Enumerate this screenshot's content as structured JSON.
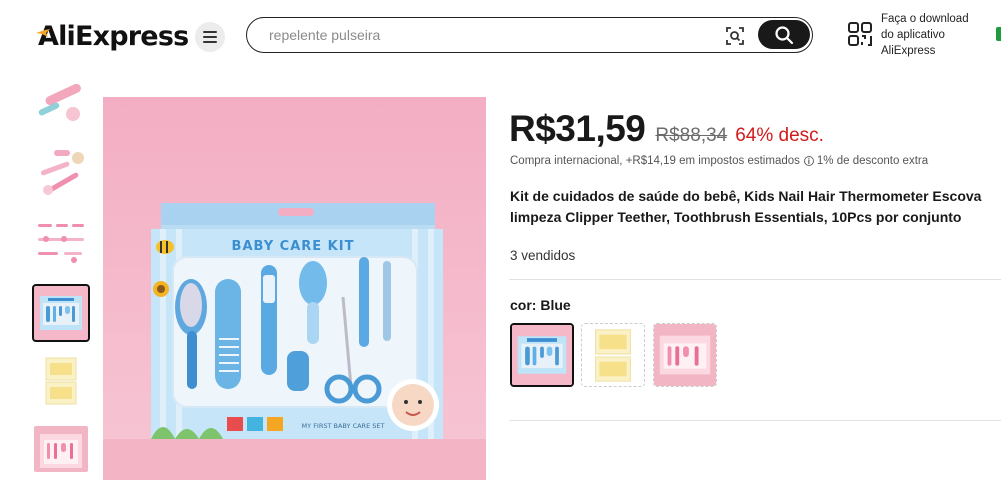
{
  "header": {
    "logo_text": "AliExpress",
    "search": {
      "placeholder": "repelente pulseira",
      "value": ""
    },
    "download_lines": [
      "Faça o download",
      "do aplicativo",
      "AliExpress"
    ]
  },
  "gallery": {
    "thumbnails": [
      {
        "name": "thumb-1",
        "selected": false
      },
      {
        "name": "thumb-2",
        "selected": false
      },
      {
        "name": "thumb-3",
        "selected": false
      },
      {
        "name": "thumb-4",
        "selected": true
      },
      {
        "name": "thumb-5",
        "selected": false
      },
      {
        "name": "thumb-6",
        "selected": false
      }
    ],
    "main_image": {
      "box_title": "BABY CARE KIT",
      "box_footer": "MY FIRST BABY CARE SET"
    }
  },
  "product": {
    "price": "R$31,59",
    "old_price": "R$88,34",
    "discount": "64% desc.",
    "tax_text": "Compra internacional, +R$14,19 em impostos estimados",
    "info_icon": "i",
    "extra_discount": "1% de desconto extra",
    "title_line1": "Kit de cuidados de saúde do bebê, Kids Nail Hair Thermometer Escova",
    "title_line2": "limpeza Clipper Teether, Toothbrush Essentials, 10Pcs por conjunto",
    "sold": "3 vendidos",
    "color_label": "cor: Blue",
    "variants": [
      {
        "name": "Blue",
        "selected": true
      },
      {
        "name": "Yellow",
        "selected": false
      },
      {
        "name": "Pink",
        "selected": false
      }
    ]
  },
  "colors": {
    "accent_dark": "#191919",
    "discount_red": "#d21b1b",
    "background_pink": "#f4b8c8",
    "box_blue": "#a9d6f2"
  }
}
